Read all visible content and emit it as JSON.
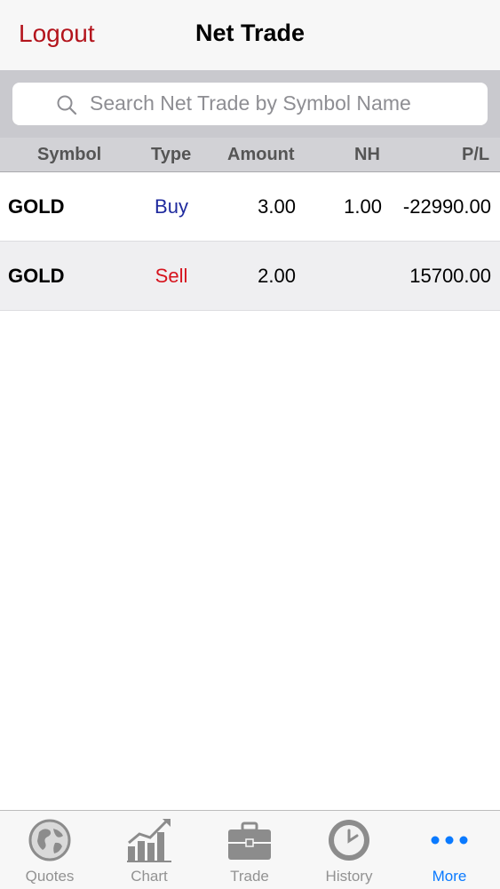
{
  "navbar": {
    "logout_label": "Logout",
    "title": "Net Trade"
  },
  "search": {
    "placeholder": "Search Net Trade by Symbol Name",
    "icon": "search-icon"
  },
  "table": {
    "columns": [
      "Symbol",
      "Type",
      "Amount",
      "NH",
      "P/L"
    ],
    "rows": [
      {
        "symbol": "GOLD",
        "type": "Buy",
        "amount": "3.00",
        "nh": "1.00",
        "pl": "-22990.00"
      },
      {
        "symbol": "GOLD",
        "type": "Sell",
        "amount": "2.00",
        "nh": "",
        "pl": "15700.00"
      }
    ]
  },
  "tabbar": {
    "items": [
      {
        "label": "Quotes",
        "icon": "globe-icon"
      },
      {
        "label": "Chart",
        "icon": "chart-icon"
      },
      {
        "label": "Trade",
        "icon": "briefcase-icon"
      },
      {
        "label": "History",
        "icon": "clock-icon"
      },
      {
        "label": "More",
        "icon": "more-dots-icon"
      }
    ],
    "active": "More"
  },
  "colors": {
    "accent_red": "#b3141c",
    "buy": "#1f2a9e",
    "sell": "#d6141e",
    "active_tab": "#0a7aff"
  }
}
